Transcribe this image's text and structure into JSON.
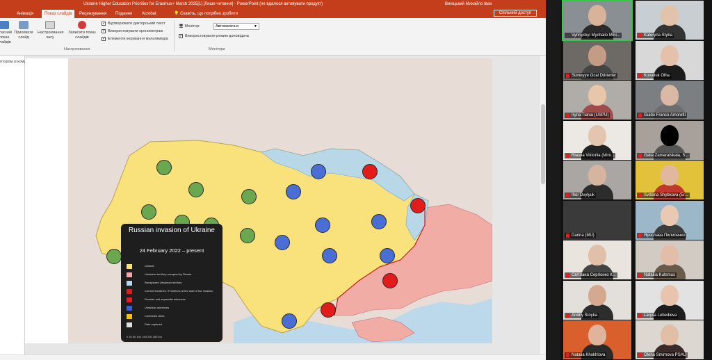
{
  "window": {
    "title": "Ukraine Higher Education Priorities for Erasmus+ March 2025[1] [Лише читання] - PowerPoint (не вдалося активувати продукт)",
    "user": "Виніцький Михайло Іван"
  },
  "ribbon": {
    "tabs": [
      "Анімація",
      "Показ слайдів",
      "Рецензування",
      "Подання",
      "Acrobat"
    ],
    "active_tab": "Показ слайдів",
    "tell_me": "Скажіть, що потрібно зробити",
    "share": "Спільний доступ",
    "buttons": [
      {
        "label": "Власний показ слайдів"
      },
      {
        "label": "Приховати слайд"
      },
      {
        "label": "Настроювання часу"
      },
      {
        "label": "Записати показ слайдів"
      }
    ],
    "checks": [
      "Відтворювати дикторський текст",
      "Використовувати хронометраж",
      "Елементи керування мультимедіа"
    ],
    "group_setup": "Настроювання",
    "monitor_label": "Монітор:",
    "monitor_value": "Автоматично",
    "presenter_view": "Використовувати режим доповідача",
    "group_monitors": "Монітори"
  },
  "notes_snippet": "отором зі кому",
  "map": {
    "legend": {
      "title": "Russian invasion of Ukraine",
      "date": "24 February 2022 – present",
      "items": [
        {
          "text": "Ukraine",
          "color": "#f9e27c"
        },
        {
          "text": "Ukrainian territory occupied by Russia",
          "color": "#f2aca6"
        },
        {
          "text": "Recaptured Ukrainian territory",
          "color": "#b8d8e8"
        },
        {
          "text": "Current frontlines / Frontlines at the start of the invasion",
          "color": "#d02020"
        },
        {
          "text": "Russian and separatist advances",
          "color": "#e02020"
        },
        {
          "text": "Ukrainian advances",
          "color": "#3a60d0"
        },
        {
          "text": "Contested cities",
          "color": "#f0c020"
        },
        {
          "text": "Date captured",
          "color": "#e0e0e0"
        }
      ],
      "scale_label": "0  25 50    100    150    200    250 km"
    },
    "colors": {
      "ukraine": "#f9e27c",
      "occupied": "#f2aca6",
      "recaptured": "#b8d8e8",
      "neighbor": "#e8ddd6",
      "sea": "#bcd9ec"
    },
    "markers": {
      "green": [
        [
          200,
          157
        ],
        [
          246,
          189
        ],
        [
          322,
          199
        ],
        [
          178,
          221
        ],
        [
          226,
          236
        ],
        [
          268,
          240
        ],
        [
          320,
          255
        ],
        [
          128,
          285
        ],
        [
          192,
          268
        ],
        [
          241,
          300
        ]
      ],
      "blue": [
        [
          422,
          163
        ],
        [
          386,
          192
        ],
        [
          428,
          240
        ],
        [
          509,
          235
        ],
        [
          370,
          265
        ],
        [
          438,
          284
        ],
        [
          521,
          284
        ],
        [
          380,
          378
        ]
      ],
      "red": [
        [
          496,
          163
        ],
        [
          565,
          212
        ],
        [
          525,
          320
        ],
        [
          436,
          362
        ]
      ]
    }
  },
  "participants": [
    {
      "name": "Vynnyckyi Mychailo Mini...",
      "muted": false,
      "speaker": true,
      "bg": "#8a8f93",
      "skin": "#d8b39a",
      "cloth": "#2a2a2a"
    },
    {
      "name": "Kateryna Styba",
      "muted": true,
      "bg": "#c9ced3",
      "skin": "#e1c2aa",
      "cloth": "#333"
    },
    {
      "name": "Sümeyye Öcal Dörterler",
      "muted": true,
      "bg": "#6d6a66",
      "skin": "#c49c86",
      "cloth": "#444"
    },
    {
      "name": "Kovaliuk Olha",
      "muted": true,
      "bg": "#d8d8d8",
      "skin": "#e5c1ab",
      "cloth": "#1b1b1b"
    },
    {
      "name": "Iryna Tiahai (USPU)",
      "muted": true,
      "bg": "#b0aca7",
      "skin": "#e7c6a9",
      "cloth": "#a04a4a"
    },
    {
      "name": "Guido Franco Amoretti",
      "muted": true,
      "bg": "#7b7f82",
      "skin": "#d9b8a5",
      "cloth": "#6d6d70"
    },
    {
      "name": "Riasna Viktoriia (Mini...",
      "muted": true,
      "bg": "#ece9e4",
      "skin": "#e3c5b0",
      "cloth": "#222"
    },
    {
      "name": "Galia Zamaratskaia, S...",
      "muted": true,
      "bg": "#a8a09a",
      "skin": "#000",
      "cloth": "#555"
    },
    {
      "name": "Ihor Dvylyuk",
      "muted": true,
      "bg": "#a9a6a4",
      "skin": "#d7b4a0",
      "cloth": "#2c2c2c"
    },
    {
      "name": "Svitlana Shybkova (Er...",
      "muted": true,
      "bg": "#e2c23a",
      "skin": "#e0b89e",
      "cloth": "#c0392b"
    },
    {
      "name": "Darina (MU)",
      "muted": true,
      "bg": "#3a3a3a",
      "skin": "",
      "cloth": ""
    },
    {
      "name": "Ярослава Пилипенко",
      "muted": true,
      "bg": "#9cb7c7",
      "skin": "#e9c9b4",
      "cloth": "#3d3d3d"
    },
    {
      "name": "Світлана Сергієнко К...",
      "muted": true,
      "bg": "#e9e4de",
      "skin": "#e0c0a8",
      "cloth": "#444"
    },
    {
      "name": "Nataliia Kutsmus",
      "muted": true,
      "bg": "#d2cbc4",
      "skin": "#e2bea8",
      "cloth": "#6a5a4a"
    },
    {
      "name": "Andriy Stoyka",
      "muted": true,
      "bg": "#e3e0dc",
      "skin": "#d4a98f",
      "cloth": "#2d2d2d"
    },
    {
      "name": "Larysa Lebedieva",
      "muted": true,
      "bg": "#e2e2e2",
      "skin": "#e6c4ad",
      "cloth": "#1d1d1d"
    },
    {
      "name": "Natalia Khokhlova",
      "muted": true,
      "bg": "#d95f2c",
      "skin": "#e0b49a",
      "cloth": "#2a2a2a"
    },
    {
      "name": "Olena Smirnova PSAU",
      "muted": true,
      "bg": "#dcd7d1",
      "skin": "#e0bfa6",
      "cloth": "#3a2a2a"
    }
  ]
}
